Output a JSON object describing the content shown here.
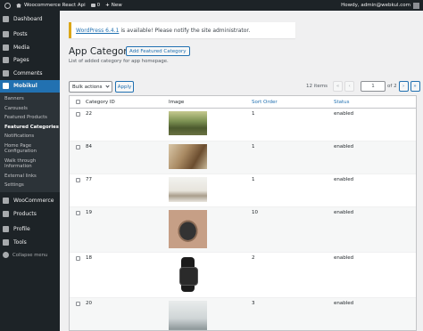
{
  "adminbar": {
    "site_name": "Woocommerce React Api",
    "comments_count": "0",
    "new_label": "New",
    "greeting": "Howdy, admin@webkul.com"
  },
  "sidebar": {
    "items": [
      {
        "label": "Dashboard",
        "icon": "dashboard-icon"
      },
      {
        "label": "Posts",
        "icon": "pin-icon"
      },
      {
        "label": "Media",
        "icon": "media-icon"
      },
      {
        "label": "Pages",
        "icon": "page-icon"
      },
      {
        "label": "Comments",
        "icon": "comment-icon"
      },
      {
        "label": "Mobikul",
        "icon": "mobikul-icon"
      }
    ],
    "submenu": [
      "Banners",
      "Carousels",
      "Featured Products",
      "Featured Categories",
      "Notifications",
      "Home Page Configuration",
      "Walk through Information",
      "External links",
      "Settings"
    ],
    "bottom_items": [
      {
        "label": "WooCommerce",
        "icon": "woocommerce-icon"
      },
      {
        "label": "Products",
        "icon": "products-icon"
      },
      {
        "label": "Profile",
        "icon": "user-icon"
      },
      {
        "label": "Tools",
        "icon": "wrench-icon"
      }
    ],
    "collapse_label": "Collapse menu"
  },
  "notice": {
    "link_text": "WordPress 6.4.1",
    "text": "is available! Please notify the site administrator."
  },
  "page": {
    "title": "App Category",
    "add_button": "Add Featured Category",
    "subtitle": "List of added category for app homepage."
  },
  "tablenav": {
    "bulk_actions": "Bulk actions",
    "apply": "Apply",
    "items_count": "12 items",
    "first": "«",
    "prev": "‹",
    "current_page": "1",
    "of_pages": "of 2",
    "next": "›",
    "last": "»"
  },
  "table": {
    "headers": {
      "id": "Category ID",
      "image": "Image",
      "sort": "Sort Order",
      "status": "Status"
    },
    "rows": [
      {
        "id": "22",
        "sort": "1",
        "status": "enabled",
        "image": "park-photo"
      },
      {
        "id": "84",
        "sort": "1",
        "status": "enabled",
        "image": "living-room-photo"
      },
      {
        "id": "77",
        "sort": "1",
        "status": "enabled",
        "image": "desk-photo"
      },
      {
        "id": "19",
        "sort": "10",
        "status": "enabled",
        "image": "smartwatch-brown-photo"
      },
      {
        "id": "18",
        "sort": "2",
        "status": "enabled",
        "image": "smartwatch-black-photo"
      },
      {
        "id": "20",
        "sort": "3",
        "status": "enabled",
        "image": "speaker-photo"
      }
    ]
  }
}
